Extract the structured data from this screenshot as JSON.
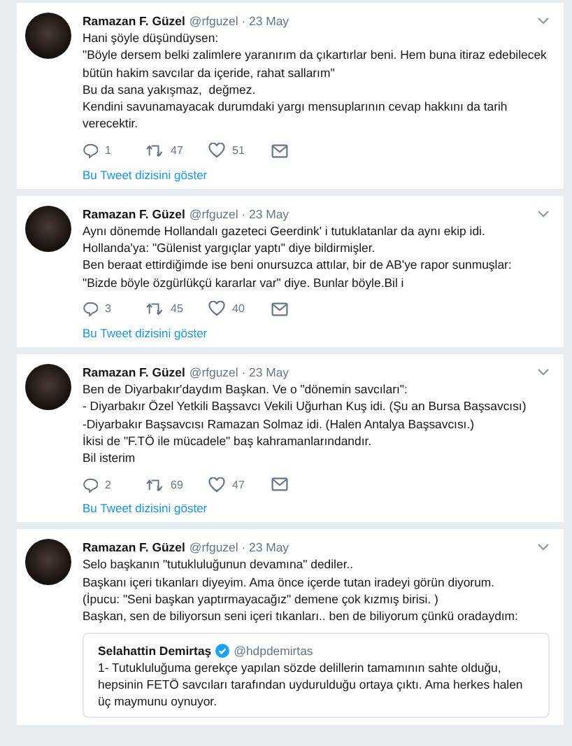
{
  "tweets": [
    {
      "author": "Ramazan F. Güzel",
      "meta": "@rfguzel · 23 May",
      "text": "Hani şöyle düşündüysen:\n\"Böyle dersem belki zalimlere yaranırım da çıkartırlar beni. Hem buna itiraz edebilecek bütün hakim savcılar da içeride, rahat sallarım\"\nBu da sana yakışmaz,  değmez.\nKendini savunamayacak durumdaki yargı mensuplarının cevap hakkını da tarih verecektir.",
      "replies": "1",
      "retweets": "47",
      "likes": "51",
      "thread_link": "Bu Tweet dizisini göster"
    },
    {
      "author": "Ramazan F. Güzel",
      "meta": "@rfguzel · 23 May",
      "text": "Aynı dönemde Hollandalı gazeteci Geerdink' i tutuklatanlar da aynı ekip idi.\nHollanda'ya: \"Gülenist yargıçlar yaptı\" diye bildirmişler.\nBen beraat ettirdiğimde ise beni onursuzca attılar, bir de AB'ye rapor sunmuşlar: \"Bizde böyle özgürlükçü kararlar var\" diye. Bunlar böyle.Bil i",
      "replies": "3",
      "retweets": "45",
      "likes": "40",
      "thread_link": "Bu Tweet dizisini göster"
    },
    {
      "author": "Ramazan F. Güzel",
      "meta": "@rfguzel · 23 May",
      "text": "Ben de Diyarbakır'daydım Başkan. Ve o \"dönemin savcıları\":\n- Diyarbakır Özel Yetkili Başsavcı Vekili Uğurhan Kuş idi. (Şu an Bursa Başsavcısı)\n-Diyarbakır Başsavcısı Ramazan Solmaz idi. (Halen Antalya Başsavcısı.)\nİkisi de \"F.TÖ ile mücadele\" baş kahramanlarındandır.\nBil isterim",
      "replies": "2",
      "retweets": "69",
      "likes": "47",
      "thread_link": "Bu Tweet dizisini göster"
    },
    {
      "author": "Ramazan F. Güzel",
      "meta": "@rfguzel · 23 May",
      "text": "Selo başkanın \"tutukluluğunun devamına\" dediler..\nBaşkanı içeri tıkanları diyeyim. Ama önce içerde tutan iradeyi görün diyorum.\n(İpucu: \"Seni başkan yaptırmayacağız\" demene çok kızmış birisi. )\nBaşkan, sen de biliyorsun seni içeri tıkanları.. ben de biliyorum çünkü oradaydım:",
      "quoted": {
        "author": "Selahattin Demirtaş",
        "verified": true,
        "handle": "@hdpdemirtas",
        "text": "1- Tutukluluğuma gerekçe yapılan sözde delillerin tamamının sahte olduğu, hepsinin FETÖ savcıları tarafından uydurulduğu ortaya çıktı. Ama herkes halen üç maymunu oynuyor."
      }
    }
  ]
}
